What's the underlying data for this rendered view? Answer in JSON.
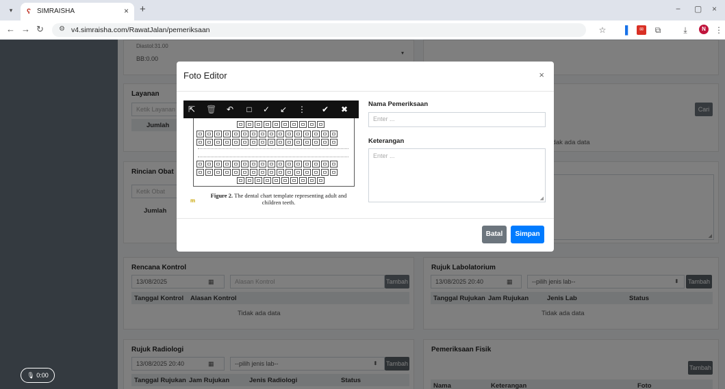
{
  "browser": {
    "tab_title": "SIMRAISHA",
    "url": "v4.simraisha.com/RawatJalan/pemeriksaan"
  },
  "record": {
    "label": "0:00"
  },
  "bg": {
    "vital_partial": "Diastol:31.00",
    "vital_bb": "BB:0.00",
    "layanan": {
      "title": "Layanan",
      "placeholder": "Ketik Layanan",
      "col_jumlah": "Jumlah"
    },
    "right_top": {
      "search_label": "Cari",
      "nodata": "Tidak ada data"
    },
    "rincian_obat": {
      "title": "Rincian Obat",
      "placeholder": "Ketik Obat",
      "col_jumlah": "Jumlah"
    },
    "rencana_kontrol": {
      "title": "Rencana Kontrol",
      "date": "13/08/2025",
      "reason_placeholder": "Alasan Kontrol",
      "add_label": "Tambah",
      "columns": [
        "Tanggal Kontrol",
        "Alasan Kontrol"
      ],
      "nodata": "Tidak ada data"
    },
    "rujuk_lab": {
      "title": "Rujuk Labolatorium",
      "datetime": "13/08/2025 20:40",
      "select": "--pilih jenis lab--",
      "add_label": "Tambah",
      "columns": [
        "Tanggal Rujukan",
        "Jam Rujukan",
        "Jenis Lab",
        "Status"
      ],
      "nodata": "Tidak ada data"
    },
    "rujuk_radiologi": {
      "title": "Rujuk Radiologi",
      "datetime": "13/08/2025 20:40",
      "select": "--pilih jenis lab--",
      "add_label": "Tambah",
      "columns": [
        "Tanggal Rujukan",
        "Jam Rujukan",
        "Jenis Radiologi",
        "Status"
      ]
    },
    "pemeriksaan_fisik": {
      "title": "Pemeriksaan Fisik",
      "add_label": "Tambah",
      "columns": [
        "Nama",
        "Keterangan",
        "Foto"
      ]
    }
  },
  "modal": {
    "title": "Foto Editor",
    "caption_bold": "Figure 2.",
    "caption_text": " The dental chart template representing adult and children teeth.",
    "nama_label": "Nama Pemeriksaan",
    "nama_placeholder": "Enter ...",
    "keterangan_label": "Keterangan",
    "keterangan_placeholder": "Enter ...",
    "cancel_label": "Batal",
    "save_label": "Simpan"
  },
  "colors": {
    "primary": "#007bff",
    "secondary": "#6c757d",
    "sidebar": "#343a40"
  }
}
